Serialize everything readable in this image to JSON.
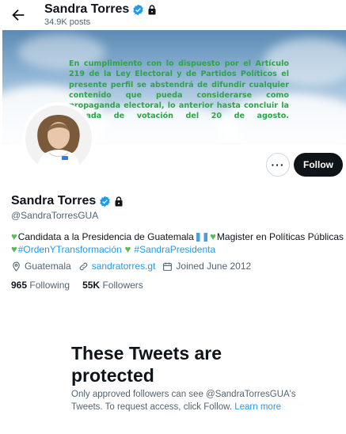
{
  "header": {
    "name": "Sandra Torres",
    "post_count": "34.9K posts"
  },
  "banner": {
    "text": "En cumplimiento con lo dispuesto por el Artículo 219 de la Ley Electoral y de Partidos Políticos el presente perfil se abstendrá de difundir cualquier contenido que pueda considerarse como propaganda electoral, lo anterior hasta concluir la jornada de votación del 20 de agosto."
  },
  "actions": {
    "more_label": "···",
    "follow_label": "Follow"
  },
  "profile": {
    "name": "Sandra Torres",
    "handle": "@SandraTorresGUA",
    "bio": {
      "line1_a": "Candidata a la Presidencia de Guatemala",
      "line1_b": "Magister en Políticas Públicas",
      "hashtag1": "#OrdenYTransformación",
      "hashtag2": "#SandraPresidenta"
    },
    "location": "Guatemala",
    "website": "sandratorres.gt",
    "joined": "Joined June 2012",
    "following_count": "965",
    "following_label": "Following",
    "followers_count": "55K",
    "followers_label": "Followers"
  },
  "protected": {
    "title": "These Tweets are protected",
    "description": "Only approved followers can see @SandraTorresGUA's Tweets. To request access, click Follow.",
    "learn_more": "Learn more"
  },
  "colors": {
    "accent": "#1d9bf0",
    "banner_text": "#2fa447",
    "heart": "#5cb85c",
    "follow_bg": "#0f1419"
  },
  "icons": [
    "back-arrow-icon",
    "verified-icon",
    "lock-icon",
    "location-icon",
    "link-icon",
    "calendar-icon",
    "heart-icon",
    "flag-icon"
  ]
}
